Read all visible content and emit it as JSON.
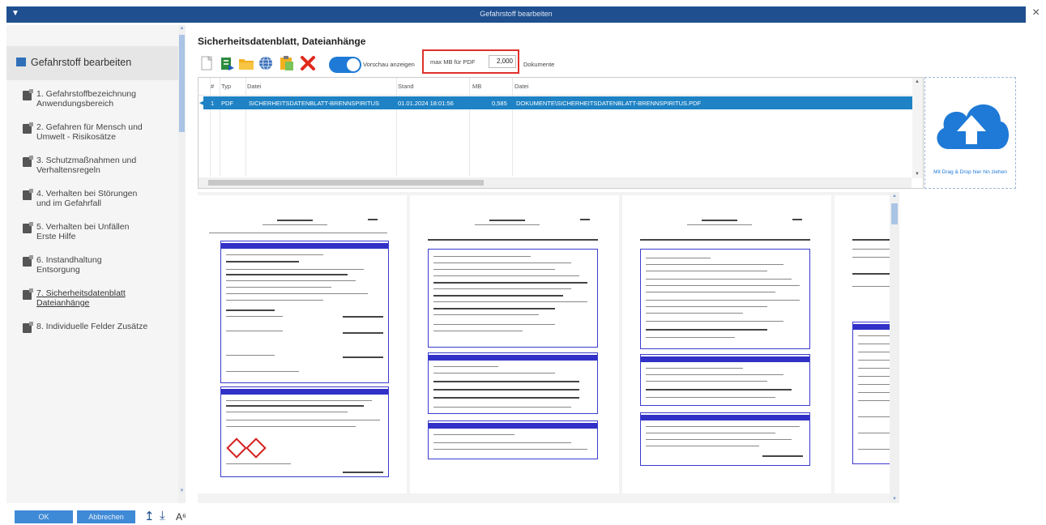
{
  "window": {
    "title": "Gefahrstoff bearbeiten",
    "close_glyph": "×"
  },
  "sidebar": {
    "header": "Gefahrstoff bearbeiten",
    "items": [
      {
        "label": "1. Gefahrstoffbezeichnung\nAnwendungsbereich"
      },
      {
        "label": "2. Gefahren für  Mensch und\nUmwelt - Risikosätze"
      },
      {
        "label": "3. Schutzmaßnahmen und\nVerhaltensregeln"
      },
      {
        "label": "4. Verhalten bei Störungen\nund im Gefahrfall"
      },
      {
        "label": "5. Verhalten bei Unfällen\nErste Hilfe"
      },
      {
        "label": "6. Instandhaltung\nEntsorgung"
      },
      {
        "label": "7. Sicherheitsdatenblatt\nDateianhänge",
        "active": true
      },
      {
        "label": "8. Individuelle Felder  Zusätze"
      }
    ]
  },
  "main": {
    "title": "Sicherheitsdatenblatt, Dateianhänge",
    "toolbar": {
      "icons": [
        "new-document-icon",
        "excel-export-icon",
        "folder-open-icon",
        "web-link-icon",
        "paste-icon",
        "delete-icon"
      ],
      "preview_toggle_label": "Vorschau anzeigen",
      "preview_toggle_on": true,
      "max_mb_label": "max MB für PDF",
      "max_mb_value": "2,000",
      "documents_label": "Dokumente"
    },
    "table": {
      "columns": [
        "#",
        "Typ",
        "Datei",
        "Stand",
        "MB",
        "Datei"
      ],
      "rows": [
        {
          "nr": "1",
          "type": "PDF",
          "file": "SICHERHEITSDATENBLATT-BRENNSPIRITUS",
          "stand": "01.01.2024 18:01:56",
          "mb": "0,585",
          "file2": "DOKUMENTE\\SICHERHEITSDATENBLATT-BRENNSPIRITUS.PDF"
        }
      ]
    },
    "dropzone": {
      "text": "Mit Drag & Drop hier hin ziehen",
      "icon": "cloud-upload-icon"
    },
    "preview": {
      "pages": 4
    }
  },
  "footer": {
    "ok_label": "OK",
    "cancel_label": "Abbrechen",
    "icons": [
      "upload-icon",
      "download-icon",
      "spellcheck-icon"
    ]
  },
  "colors": {
    "titlebar": "#1f4f8f",
    "accent": "#1e82c4",
    "highlight_box": "#e0302b",
    "doc_band": "#3131c8"
  }
}
